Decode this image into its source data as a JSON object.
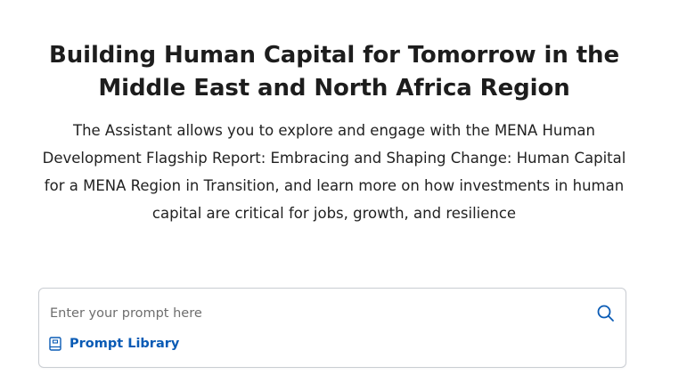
{
  "hero": {
    "title": "Building Human Capital for Tomorrow in the Middle East and North Africa Region",
    "description": "The Assistant allows you to explore and engage with the MENA Human Development Flagship Report: Embracing and Shaping Change: Human Capital for a MENA Region in Transition, and learn more on how investments in human capital are critical for jobs, growth, and resilience"
  },
  "prompt": {
    "placeholder": "Enter your prompt here",
    "value": "",
    "search_icon": "search-icon",
    "library_icon": "book-icon",
    "library_label": "Prompt Library"
  },
  "colors": {
    "accent": "#0a5bb5",
    "border": "#c9cdd2",
    "text": "#222222"
  }
}
